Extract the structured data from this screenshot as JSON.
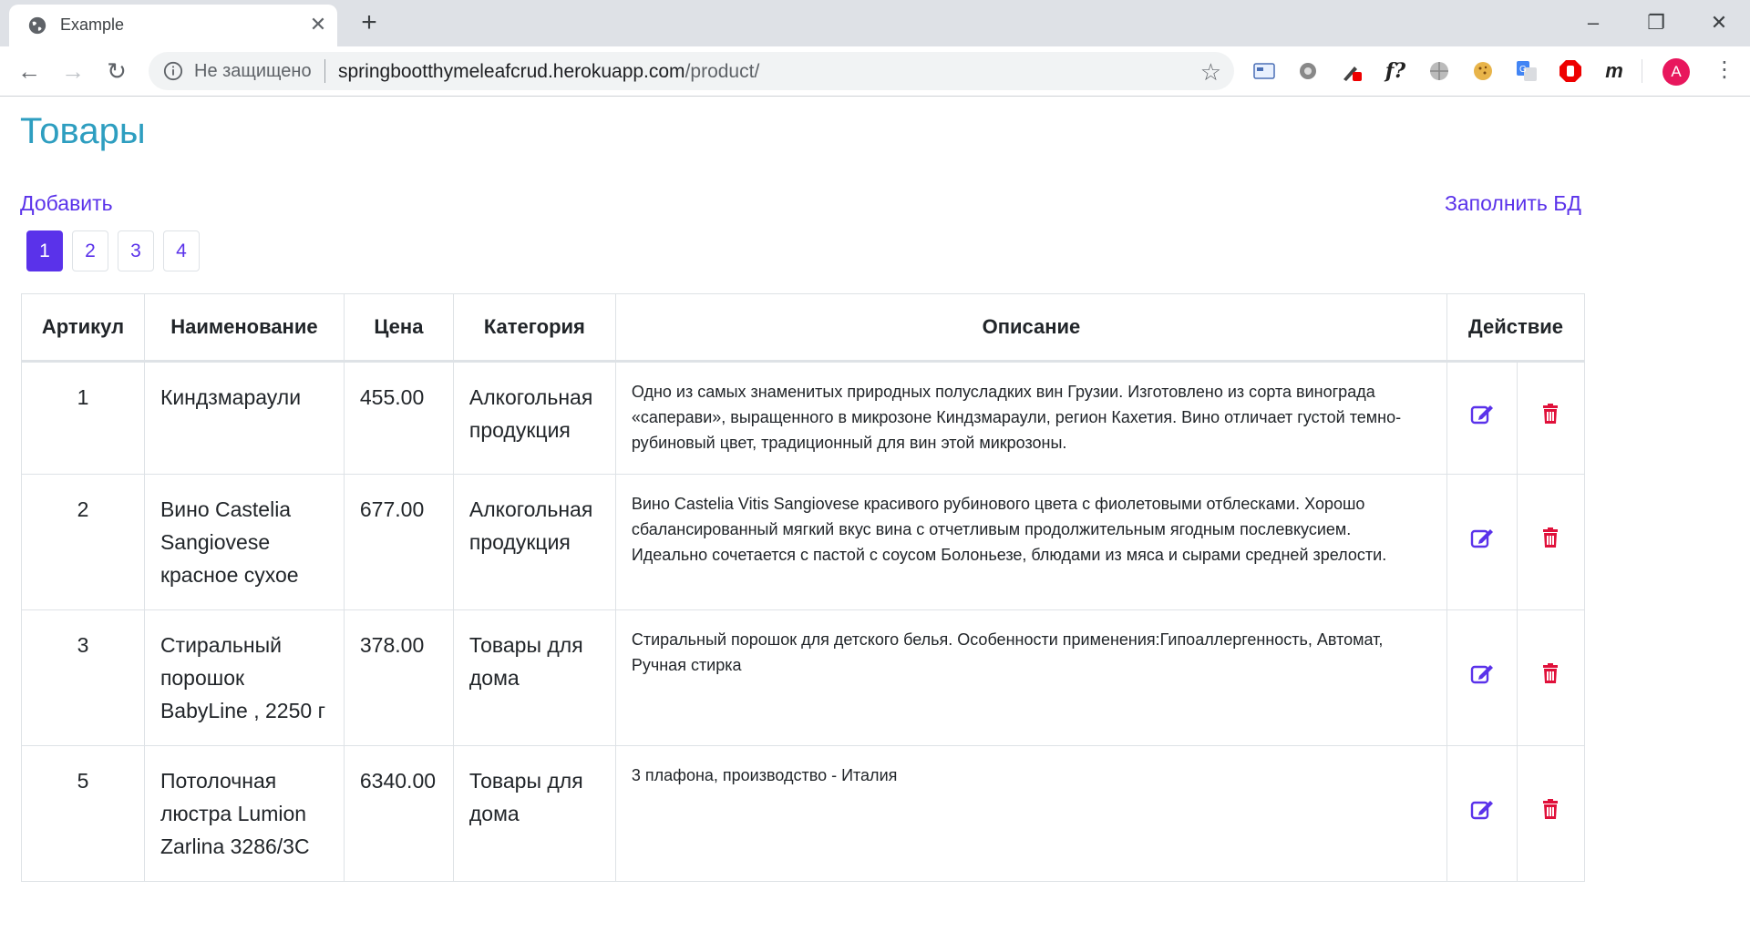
{
  "browser": {
    "tab_title": "Example",
    "url_security": "Не защищено",
    "url_host": "springbootthymeleafcrud.herokuapp.com",
    "url_path": "/product/",
    "profile_initial": "A",
    "extension_f_label": "f?",
    "extension_m_label": "m"
  },
  "page": {
    "title": "Товары",
    "add_label": "Добавить",
    "fill_db_label": "Заполнить БД",
    "pages": [
      "1",
      "2",
      "3",
      "4"
    ],
    "active_page": "1"
  },
  "table": {
    "headers": [
      "Артикул",
      "Наименование",
      "Цена",
      "Категория",
      "Описание",
      "Действие"
    ],
    "rows": [
      {
        "id": "1",
        "name": "Киндзмараули",
        "price": "455.00",
        "category": "Алкогольная продукция",
        "description": "Одно из самых знаменитых природных полусладких вин Грузии. Изготовлено из сорта винограда «саперави», выращенного в микрозоне Киндзмараули, регион Кахетия. Вино отличает густой темно-рубиновый цвет, традиционный для вин этой микрозоны."
      },
      {
        "id": "2",
        "name": "Вино Castelia Sangiovese красное сухое",
        "price": "677.00",
        "category": "Алкогольная продукция",
        "description": "Вино Castelia Vitis Sangiovese красивого рубинового цвета с фиолетовыми отблесками. Хорошо сбалансированный мягкий вкус вина с отчетливым продолжительным ягодным послевкусием. Идеально сочетается с пастой с соусом Болоньезе, блюдами из мяса и сырами средней зрелости."
      },
      {
        "id": "3",
        "name": "Стиральный порошок BabyLine , 2250 г",
        "price": "378.00",
        "category": "Товары для дома",
        "description": "Стиральный порошок для детского белья. Особенности применения:Гипоаллергенность, Автомат, Ручная стирка"
      },
      {
        "id": "5",
        "name": "Потолочная люстра Lumion Zarlina 3286/3C",
        "price": "6340.00",
        "category": "Товары для дома",
        "description": "3 плафона, производство - Италия"
      }
    ]
  },
  "colors": {
    "title": "#2e9ec0",
    "link": "#5a32ea",
    "delete": "#e0103a",
    "profile": "#e8175d"
  }
}
